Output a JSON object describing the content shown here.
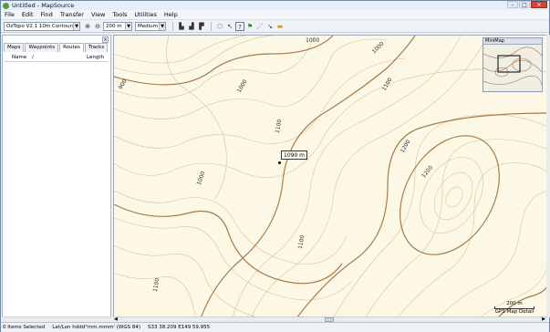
{
  "window": {
    "title": "Untitled - MapSource",
    "minimize": "–",
    "maximize": "□",
    "close": "✕"
  },
  "menu": [
    "File",
    "Edit",
    "Find",
    "Transfer",
    "View",
    "Tools",
    "Utilities",
    "Help"
  ],
  "toolbar": {
    "map_product": "OzTopo V2.1 10m Contours",
    "zoom_level": "200 m",
    "detail": "Medium"
  },
  "left_panel": {
    "tabs": [
      "Maps",
      "Waypoints",
      "Routes",
      "Tracks"
    ],
    "active_tab": "Routes",
    "close": "×",
    "columns": {
      "name": "Name",
      "sort": "/",
      "length": "Length"
    }
  },
  "map": {
    "tooltip": "1090 m",
    "minimap_title": "MiniMap",
    "scale": "200 m",
    "detail_label": "GPS Map Detail",
    "contour_labels": [
      "1000",
      "900",
      "1000",
      "1000",
      "1100",
      "1000",
      "1100",
      "1200",
      "1200",
      "1100",
      "1100"
    ]
  },
  "status": {
    "selected": "0 Items Selected",
    "format": "Lat/Lon hddd°mm.mmm' (WGS 84)",
    "coords": "S33 38.209 E149 59.955"
  },
  "colors": {
    "map_bg": "#fdf8e6",
    "contour_major": "#9a6a3a",
    "contour_minor": "#d0b48a"
  }
}
